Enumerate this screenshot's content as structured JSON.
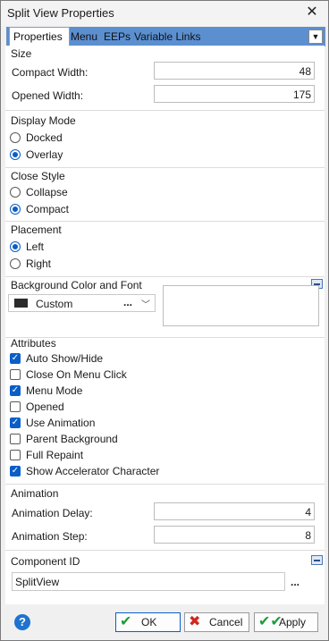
{
  "window": {
    "title": "Split View Properties",
    "close_icon": "close-icon"
  },
  "tabs": [
    {
      "label": "Properties",
      "active": true
    },
    {
      "label": "Menu",
      "active": false
    },
    {
      "label": "EEPs",
      "active": false
    },
    {
      "label": "Variable Links",
      "active": false
    }
  ],
  "size": {
    "heading": "Size",
    "compact_width_label": "Compact Width:",
    "compact_width_value": "48",
    "opened_width_label": "Opened Width:",
    "opened_width_value": "175"
  },
  "display_mode": {
    "heading": "Display Mode",
    "options": [
      {
        "label": "Docked",
        "selected": false
      },
      {
        "label": "Overlay",
        "selected": true
      }
    ]
  },
  "close_style": {
    "heading": "Close Style",
    "options": [
      {
        "label": "Collapse",
        "selected": false
      },
      {
        "label": "Compact",
        "selected": true
      }
    ]
  },
  "placement": {
    "heading": "Placement",
    "options": [
      {
        "label": "Left",
        "selected": true
      },
      {
        "label": "Right",
        "selected": false
      }
    ]
  },
  "background": {
    "heading": "Background Color and Font",
    "color_value": "Custom",
    "swatch_color": "#2b2b2b",
    "browse_label": "..."
  },
  "attributes": {
    "heading": "Attributes",
    "items": [
      {
        "label": "Auto Show/Hide",
        "checked": true
      },
      {
        "label": "Close On Menu Click",
        "checked": false
      },
      {
        "label": "Menu Mode",
        "checked": true
      },
      {
        "label": "Opened",
        "checked": false
      },
      {
        "label": "Use Animation",
        "checked": true
      },
      {
        "label": "Parent Background",
        "checked": false
      },
      {
        "label": "Full Repaint",
        "checked": false
      },
      {
        "label": "Show Accelerator Character",
        "checked": true
      }
    ]
  },
  "animation": {
    "heading": "Animation",
    "delay_label": "Animation Delay:",
    "delay_value": "4",
    "step_label": "Animation Step:",
    "step_value": "8"
  },
  "component_id": {
    "heading": "Component ID",
    "value": "SplitView",
    "browse_label": "..."
  },
  "footer": {
    "help_label": "?",
    "ok_label": "OK",
    "cancel_label": "Cancel",
    "apply_label": "Apply"
  },
  "colors": {
    "accent": "#0a5ec6",
    "tab_strip": "#5b8fd0",
    "ok_check": "#1e9e3a",
    "cancel_x": "#d0281f"
  }
}
